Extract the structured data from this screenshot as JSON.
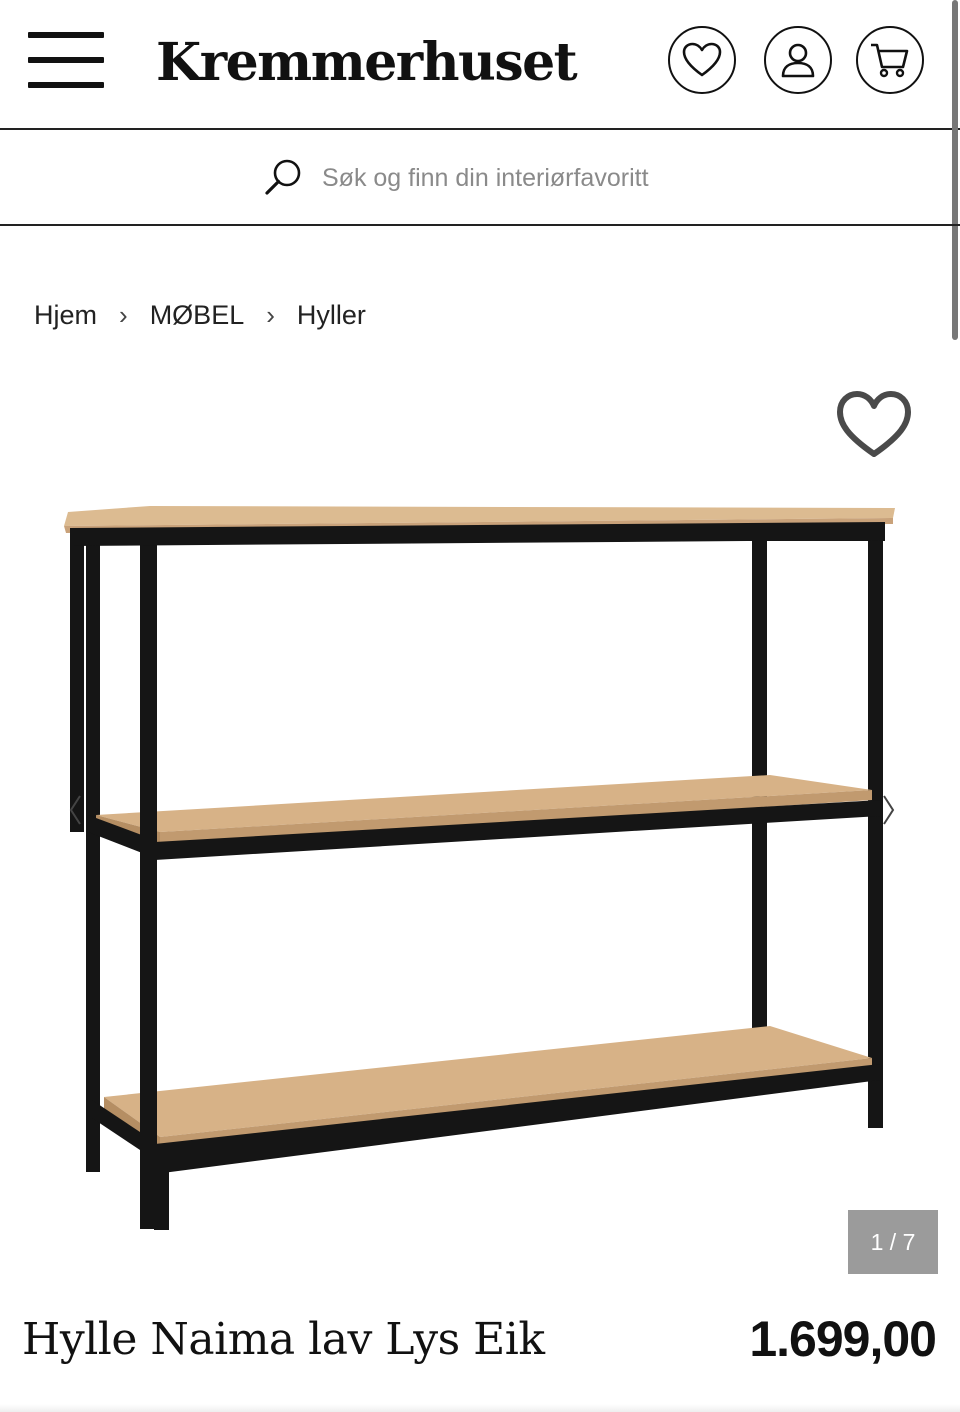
{
  "header": {
    "logo": "Kremmerhuset",
    "menu_icon": "hamburger-menu-icon",
    "wishlist_icon": "heart-icon",
    "account_icon": "user-icon",
    "cart_icon": "cart-icon"
  },
  "search": {
    "placeholder": "Søk og finn din interiørfavoritt",
    "icon": "search-icon"
  },
  "breadcrumb": {
    "items": [
      "Hjem",
      "MØBEL",
      "Hyller"
    ],
    "separator": "›"
  },
  "gallery": {
    "counter": "1 / 7",
    "favorite_icon": "heart-outline-icon",
    "prev_icon": "chevron-left-icon",
    "next_icon": "chevron-right-icon"
  },
  "product": {
    "title": "Hylle Naima lav Lys Eik",
    "price": "1.699,00"
  },
  "colors": {
    "text": "#111111",
    "counter_bg": "#9b9b9b",
    "wood": "#d9b68a",
    "frame": "#151515"
  }
}
